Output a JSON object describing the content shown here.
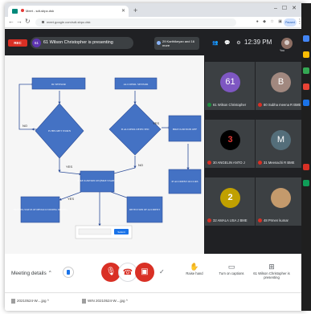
{
  "browser": {
    "tab_title": "Meet - sdt-sbpz-dsk",
    "url": "meet.google.com/sdt-sbpz-dsk",
    "profile_label": "Paused"
  },
  "meeting": {
    "rec_label": "REC",
    "presenter_initials": "61",
    "presenter_text": "61 Wilson Christopher is presenting",
    "others_text": "29 Karthikeyan and 16 more",
    "clock": "12:39 PM",
    "self_label": "You"
  },
  "flowchart": {
    "boxes": [
      {
        "label": "IR SENSOR"
      },
      {
        "label": "ALCOHOL SENSOR"
      },
      {
        "label": "BIKE IGNITION OFF"
      },
      {
        "label": "BIKE IGNITION ON (BIKE STARTS)"
      },
      {
        "label": "IF ACCIDENT OCCURS"
      },
      {
        "label": "SHOWING STATUS OF OBSTACLE DURING DRIVING"
      },
      {
        "label": "DETECTION OF ACCIDENT"
      }
    ],
    "diamonds": [
      {
        "label": "IS HELMET WORN"
      },
      {
        "label": "IS ALCOHOL DETECTED"
      }
    ],
    "edge_labels": [
      "NO",
      "YES",
      "YES",
      "NO",
      "YES"
    ],
    "popup_input": "",
    "popup_button": "Submit"
  },
  "participants": [
    {
      "name": "61 Wilson Christopher",
      "initial": "61",
      "color": "#7e57c2",
      "mic": "on"
    },
    {
      "name": "80 Subha meena R BME",
      "initial": "B",
      "color": "#a1887f",
      "mic": "off"
    },
    {
      "name": "30 ANGELIN ANTO J",
      "initial": "3",
      "color": "#000000",
      "mic": "off"
    },
    {
      "name": "31 Meenachi R BME",
      "initial": "M",
      "color": "#546e7a",
      "mic": "off"
    },
    {
      "name": "32 AMALA USA J BME",
      "initial": "2",
      "color": "#c0a000",
      "mic": "off"
    },
    {
      "name": "48 Prmen kumar",
      "initial": "",
      "color": "#c49a6c",
      "mic": "off"
    }
  ],
  "controls": {
    "meeting_details": "Meeting details",
    "raise_hand": "Raise hand",
    "captions": "Turn on captions",
    "presenting": "61 Wilson Christopher is presenting"
  },
  "downloads": [
    {
      "name": "20210524-W....jpg"
    },
    {
      "name": "WIN 20210524-W....jpg"
    }
  ]
}
